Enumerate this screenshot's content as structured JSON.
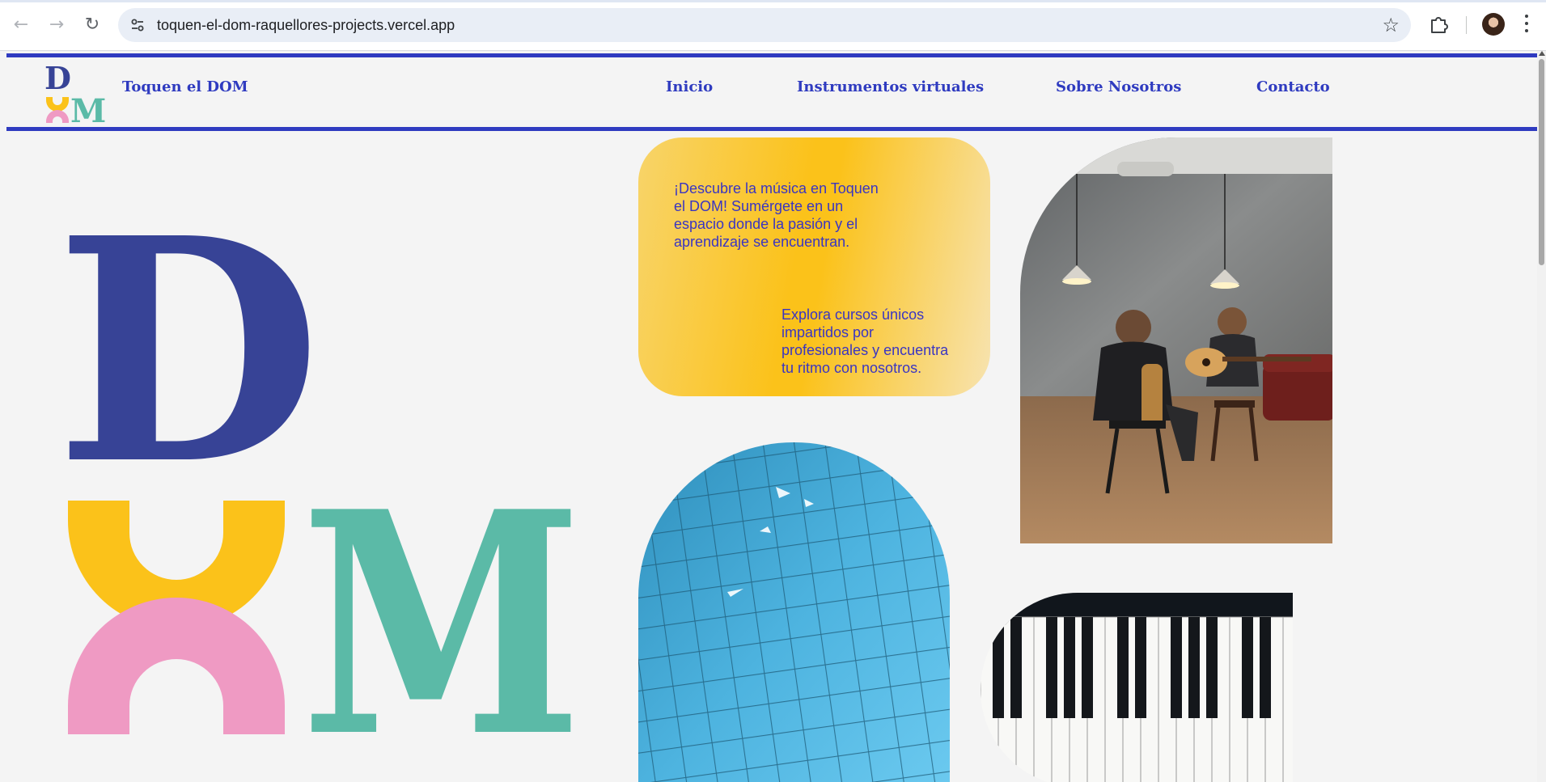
{
  "browser": {
    "url": "toquen-el-dom-raquellores-projects.vercel.app",
    "back_icon": "←",
    "forward_icon": "→",
    "reload_icon": "↻",
    "bookmark_icon": "☆"
  },
  "site": {
    "brand": "Toquen el DOM",
    "logo_letters": {
      "d": "D",
      "m": "M"
    },
    "nav": [
      {
        "label": "Inicio"
      },
      {
        "label": "Instrumentos virtuales"
      },
      {
        "label": "Sobre Nosotros"
      },
      {
        "label": "Contacto"
      }
    ],
    "hero": {
      "letter_d": "D",
      "letter_m": "M",
      "intro_text": "¡Descubre la música en Toquen el DOM! Sumérgete en un espacio donde la pasión y el aprendizaje se encuentran.",
      "courses_text": "Explora cursos únicos impartidos por profesionales y encuentra tu ritmo con nosotros."
    },
    "colors": {
      "primary": "#2f3bc0",
      "d_blue": "#374396",
      "yellow": "#fbc21a",
      "pink": "#ef9ac3",
      "teal": "#5bbaa7"
    }
  }
}
